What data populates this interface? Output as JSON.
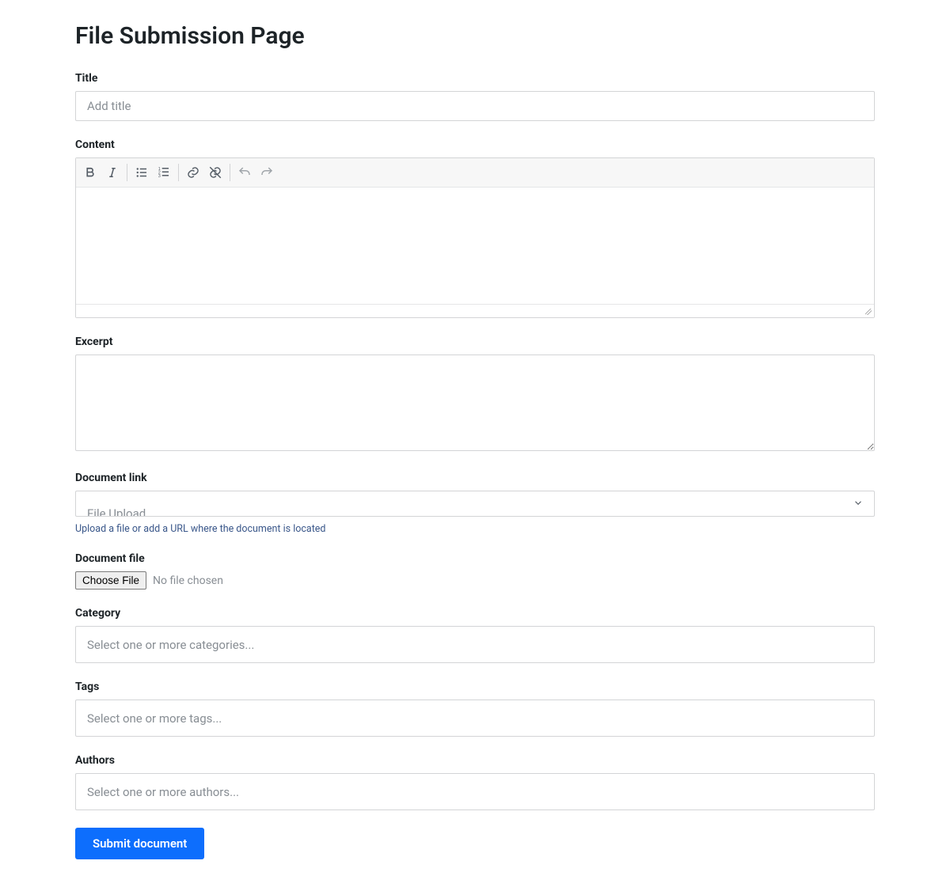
{
  "page": {
    "title": "File Submission Page"
  },
  "fields": {
    "title": {
      "label": "Title",
      "placeholder": "Add title",
      "value": ""
    },
    "content": {
      "label": "Content",
      "toolbar": {
        "bold": "bold-icon",
        "italic": "italic-icon",
        "bullet_list": "bullet-list-icon",
        "numbered_list": "numbered-list-icon",
        "link": "link-icon",
        "unlink": "unlink-icon",
        "undo": "undo-icon",
        "redo": "redo-icon"
      },
      "value": ""
    },
    "excerpt": {
      "label": "Excerpt",
      "value": ""
    },
    "document_link": {
      "label": "Document link",
      "selected_label": "File Upload",
      "help": "Upload a file or add a URL where the document is located"
    },
    "document_file": {
      "label": "Document file",
      "button_label": "Choose File",
      "status": "No file chosen"
    },
    "category": {
      "label": "Category",
      "placeholder": "Select one or more categories..."
    },
    "tags": {
      "label": "Tags",
      "placeholder": "Select one or more tags..."
    },
    "authors": {
      "label": "Authors",
      "placeholder": "Select one or more authors..."
    }
  },
  "actions": {
    "submit_label": "Submit document"
  },
  "colors": {
    "primary": "#0d6efd",
    "border": "#d3d4d6",
    "muted": "#888e94"
  }
}
